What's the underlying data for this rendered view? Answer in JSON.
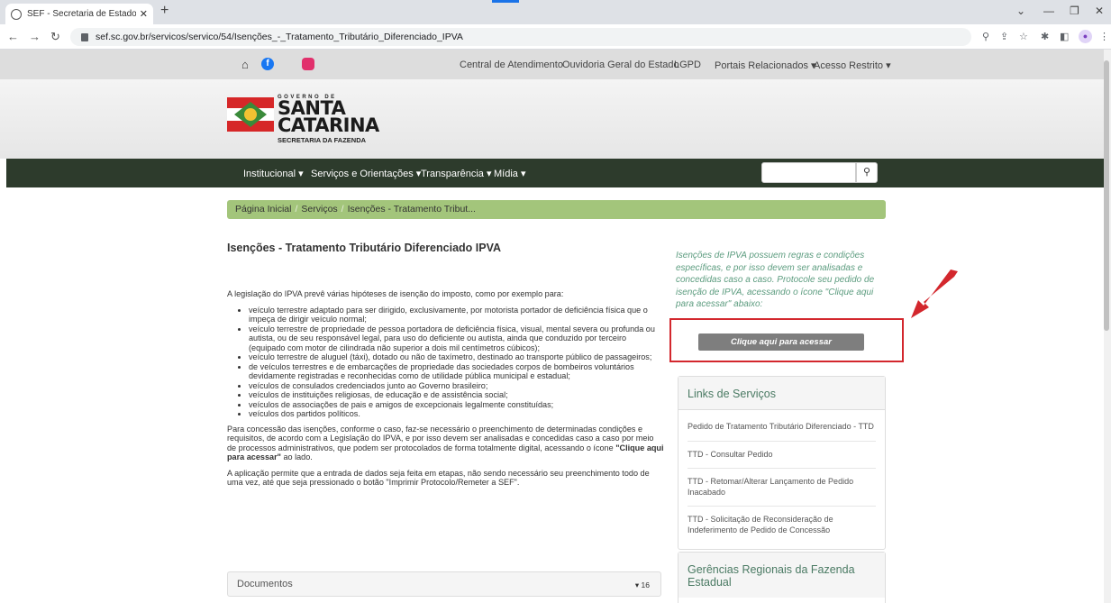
{
  "browser": {
    "tab_title": "SEF - Secretaria de Estado da Fa:",
    "url": "sef.sc.gov.br/servicos/servico/54/Isenções_-_Tratamento_Tributário_Diferenciado_IPVA"
  },
  "topbar": {
    "links": [
      "Central de Atendimento",
      "Ouvidoria Geral do Estado",
      "LGPD",
      "Portais Relacionados ▾",
      "Acesso Restrito ▾"
    ]
  },
  "logo": {
    "gov": "GOVERNO DE",
    "line1": "SANTA",
    "line2": "CATARINA",
    "sub": "SECRETARIA DA FAZENDA"
  },
  "nav": {
    "items": [
      "Institucional ▾",
      "Serviços e Orientações ▾",
      "Transparência ▾",
      "Mídia ▾"
    ],
    "search_placeholder": ""
  },
  "breadcrumb": [
    "Página Inicial",
    "Serviços",
    "Isenções - Tratamento Tribut..."
  ],
  "main": {
    "title": "Isenções - Tratamento Tributário Diferenciado IPVA",
    "intro": "A legislação do IPVA prevê várias hipóteses de isenção do imposto, como por exemplo para:",
    "items": [
      "veículo terrestre adaptado para ser dirigido, exclusivamente, por motorista portador de deficiência física que o impeça de dirigir veículo normal;",
      "veículo terrestre de propriedade de pessoa portadora de deficiência física, visual, mental severa ou profunda ou autista, ou de seu responsável legal, para uso do deficiente ou autista, ainda que conduzido por terceiro (equipado com motor de cilindrada não superior a dois mil centímetros cúbicos);",
      "veículo terrestre de aluguel (táxi), dotado ou não de taxímetro, destinado ao transporte público de passageiros;",
      "de veículos terrestres e de embarcações de propriedade das sociedades corpos de bombeiros voluntários devidamente registradas e reconhecidas como de utilidade pública municipal e estadual;",
      "veículos de consulados credenciados junto ao Governo brasileiro;",
      "veículos de instituições religiosas, de educação e de assistência social;",
      "veículos de associações de pais e amigos de excepcionais legalmente constituídas;",
      "veículos dos partidos políticos."
    ],
    "para2_a": "Para concessão das isenções, conforme o caso, faz-se necessário o preenchimento de determinadas condições e requisitos, de acordo com a Legislação do IPVA, e por isso devem ser analisadas e concedidas caso a caso por meio de processos administrativos, que podem ser protocolados de forma totalmente digital, acessando o ícone ",
    "para2_b": "\"Clique aqui para acessar\"",
    "para2_c": " ao lado.",
    "para3": "A aplicação permite que a entrada de dados seja feita em etapas, não sendo necessário seu preenchimento todo de uma vez, até que seja pressionado o botão \"Imprimir Protocolo/Remeter a SEF\".",
    "docs_label": "Documentos",
    "docs_count": "▾ 16"
  },
  "sidebar": {
    "note": "Isenções de IPVA possuem regras e condições específicas, e por isso devem ser analisadas e concedidas caso a caso. Protocole seu pedido de isenção de IPVA, acessando o ícone \"Clique aqui para acessar\" abaixo:",
    "button": "Clique aqui para acessar",
    "links_title": "Links de Serviços",
    "links": [
      "Pedido de Tratamento Tributário Diferenciado - TTD",
      "TTD - Consultar Pedido",
      "TTD - Retomar/Alterar Lançamento de Pedido Inacabado",
      "TTD - Solicitação de Reconsideração de Indeferimento de Pedido de Concessão"
    ],
    "regional_title": "Gerências Regionais da Fazenda Estadual"
  },
  "colors": {
    "nav_bg": "#2d3b2c",
    "breadcrumb_bg": "#a3c57b",
    "highlight_red": "#d3272d",
    "note_text": "#5c9c7f"
  }
}
